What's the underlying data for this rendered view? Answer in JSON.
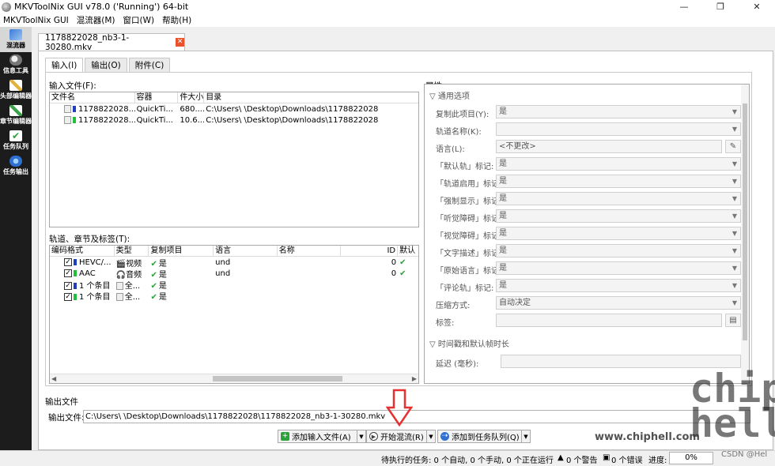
{
  "window": {
    "title": "MKVToolNix GUI v78.0 ('Running') 64-bit",
    "minimize": "—",
    "restore": "❐",
    "close": "✕"
  },
  "menu": [
    "MKVToolNix GUI",
    "混流器(M)",
    "窗口(W)",
    "帮助(H)"
  ],
  "sidebar": [
    {
      "label": "混流器",
      "icon": "multiplexer-icon"
    },
    {
      "label": "信息工具",
      "icon": "info-tool-icon"
    },
    {
      "label": "头部编辑器",
      "icon": "header-editor-icon"
    },
    {
      "label": "章节编辑器",
      "icon": "chapter-editor-icon"
    },
    {
      "label": "任务队列",
      "icon": "job-queue-icon"
    },
    {
      "label": "任务输出",
      "icon": "job-output-icon"
    }
  ],
  "file_tab": {
    "label": "1178822028_nb3-1-30280.mkv",
    "close": "✕"
  },
  "subtabs": [
    "输入(I)",
    "输出(O)",
    "附件(C)"
  ],
  "input_files": {
    "label": "输入文件(F):",
    "columns": [
      "文件名",
      "容器",
      "件大小",
      "目录"
    ],
    "rows": [
      {
        "name": "1178822028...",
        "container": "QuickTi...",
        "size": "680....",
        "dir": "C:\\Users\\    \\Desktop\\Downloads\\1178822028",
        "color": "#1f3fbf"
      },
      {
        "name": "1178822028...",
        "container": "QuickTi...",
        "size": "10.6...",
        "dir": "C:\\Users\\    \\Desktop\\Downloads\\1178822028",
        "color": "#22c03a"
      }
    ]
  },
  "tracks": {
    "label": "轨道、章节及标签(T):",
    "columns": [
      "编码格式",
      "类型",
      "复制项目",
      "语言",
      "名称",
      "ID",
      "默认"
    ],
    "rows": [
      {
        "codec": "HEVC/...",
        "type": "视频",
        "copy": "是",
        "lang": "und",
        "name": "",
        "id": "0",
        "color": "#1f3fbf"
      },
      {
        "codec": "AAC",
        "type": "音频",
        "copy": "是",
        "lang": "und",
        "name": "",
        "id": "0",
        "color": "#22c03a"
      },
      {
        "codec": "1 个条目",
        "type": "全...",
        "copy": "是",
        "lang": "",
        "name": "",
        "id": "",
        "color": "#1f3fbf"
      },
      {
        "codec": "1 个条目",
        "type": "全...",
        "copy": "是",
        "lang": "",
        "name": "",
        "id": "",
        "color": "#22c03a"
      }
    ]
  },
  "properties": {
    "label": "属性:",
    "section_general": "通用选项",
    "fields": [
      {
        "label": "复制此项目(Y):",
        "value": "是"
      },
      {
        "label": "轨道名称(K):",
        "value": ""
      },
      {
        "label": "语言(L):",
        "value": "<不更改>"
      },
      {
        "label": "「默认轨」标记:",
        "value": "是"
      },
      {
        "label": "「轨道启用」标记:",
        "value": "是"
      },
      {
        "label": "「强制显示」标记:",
        "value": "是"
      },
      {
        "label": "「听觉障碍」标记:",
        "value": "是"
      },
      {
        "label": "「视觉障碍」标记:",
        "value": "是"
      },
      {
        "label": "「文字描述」标记:",
        "value": "是"
      },
      {
        "label": "「原始语言」标记:",
        "value": "是"
      },
      {
        "label": "「评论轨」标记:",
        "value": "是"
      },
      {
        "label": "压缩方式:",
        "value": "自动决定"
      },
      {
        "label": "标签:",
        "value": ""
      }
    ],
    "section_timing": "时间戳和默认帧时长",
    "delay_label": "延迟 (毫秒):"
  },
  "output": {
    "section": "输出文件",
    "label": "输出文件:",
    "value": "C:\\Users\\    \\Desktop\\Downloads\\1178822028\\1178822028_nb3-1-30280.mkv"
  },
  "buttons": {
    "add_input": "添加输入文件(A)",
    "start_mux": "开始混流(R)",
    "add_queue": "添加到任务队列(Q)"
  },
  "status": {
    "pending": "待执行的任务: 0 个自动, 0 个手动, 0 个正在运行",
    "warnings": "0 个警告",
    "errors": "0 个错误",
    "progress_label": "进度:",
    "progress_value": "0%",
    "progress_value2": "0%"
  },
  "watermark": {
    "site": "www.chiphell.com",
    "logo": "chip\nhell",
    "csdn": "CSDN @Hel"
  },
  "colors": {
    "accent_red": "#e53131",
    "green": "#22c03a",
    "blue": "#1f3fbf",
    "sidebar": "#1c1c1c"
  }
}
